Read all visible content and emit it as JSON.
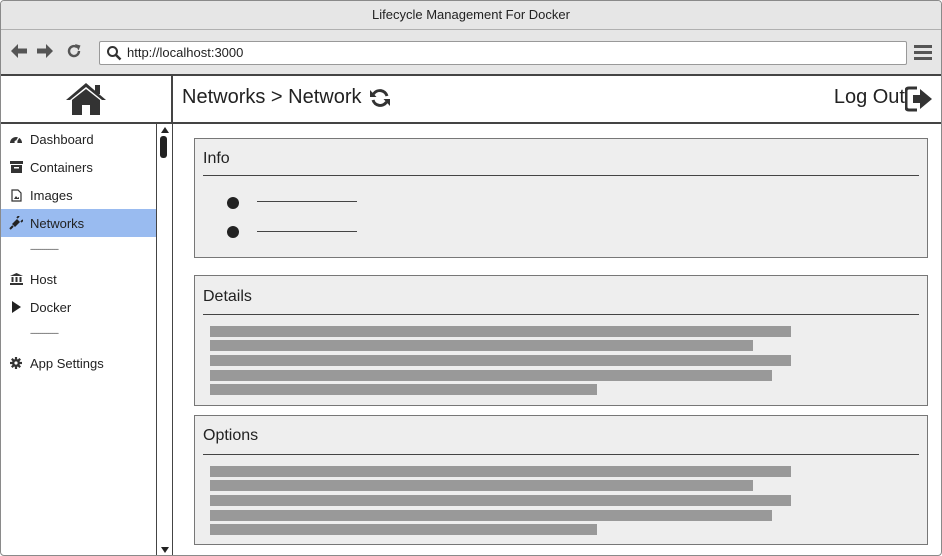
{
  "window": {
    "title": "Lifecycle Management For Docker"
  },
  "browser": {
    "url": "http://localhost:3000"
  },
  "header": {
    "breadcrumb": "Networks > Network",
    "logout_label": "Log Out"
  },
  "sidebar": {
    "items": [
      {
        "label": "Dashboard",
        "icon": "dashboard-icon"
      },
      {
        "label": "Containers",
        "icon": "archive-icon"
      },
      {
        "label": "Images",
        "icon": "file-image-icon"
      },
      {
        "label": "Networks",
        "icon": "plug-icon",
        "active": true
      },
      {
        "label": "Host",
        "icon": "bank-icon"
      },
      {
        "label": "Docker",
        "icon": "play-icon"
      },
      {
        "label": "App Settings",
        "icon": "gear-icon"
      }
    ],
    "separator": "--------------"
  },
  "panels": {
    "info": {
      "title": "Info"
    },
    "details": {
      "title": "Details"
    },
    "options": {
      "title": "Options"
    }
  },
  "colors": {
    "active_bg": "#99bbf0",
    "placeholder_bar": "#999999",
    "panel_bg": "#eeeeee"
  }
}
